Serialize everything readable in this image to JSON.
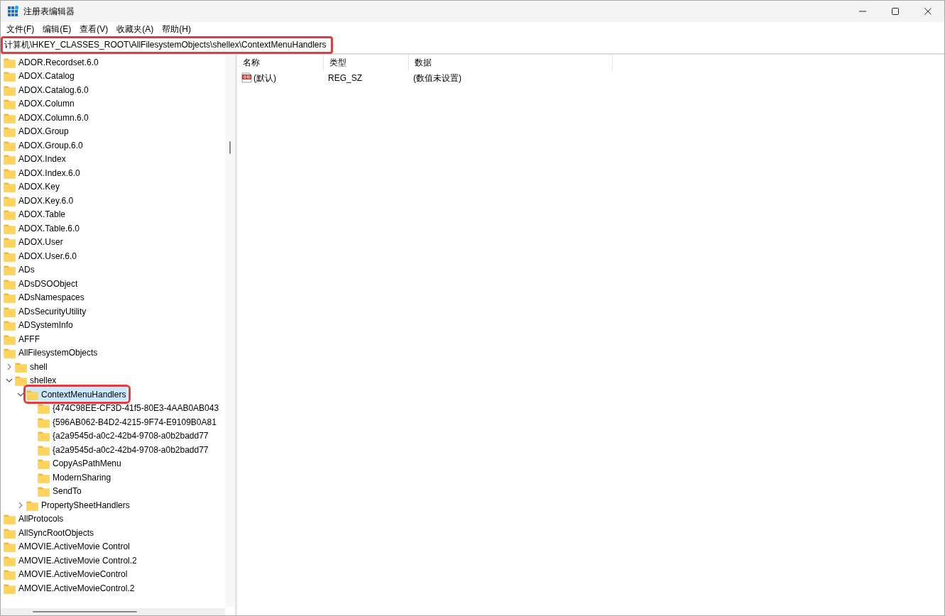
{
  "window": {
    "title": "注册表编辑器"
  },
  "menu": [
    "文件(F)",
    "编辑(E)",
    "查看(V)",
    "收藏夹(A)",
    "帮助(H)"
  ],
  "address_bar": {
    "value": "计算机\\HKEY_CLASSES_ROOT\\AllFilesystemObjects\\shellex\\ContextMenuHandlers",
    "highlighted": true
  },
  "tree": [
    {
      "label": "ADOR.Recordset.6.0",
      "selected": false
    },
    {
      "label": "ADOX.Catalog",
      "selected": false
    },
    {
      "label": "ADOX.Catalog.6.0",
      "selected": false
    },
    {
      "label": "ADOX.Column",
      "selected": false
    },
    {
      "label": "ADOX.Column.6.0",
      "selected": false
    },
    {
      "label": "ADOX.Group",
      "selected": false
    },
    {
      "label": "ADOX.Group.6.0",
      "selected": false
    },
    {
      "label": "ADOX.Index",
      "selected": false
    },
    {
      "label": "ADOX.Index.6.0",
      "selected": false
    },
    {
      "label": "ADOX.Key",
      "selected": false
    },
    {
      "label": "ADOX.Key.6.0",
      "selected": false
    },
    {
      "label": "ADOX.Table",
      "selected": false
    },
    {
      "label": "ADOX.Table.6.0",
      "selected": false
    },
    {
      "label": "ADOX.User",
      "selected": false
    },
    {
      "label": "ADOX.User.6.0",
      "selected": false
    },
    {
      "label": "ADs",
      "selected": false
    },
    {
      "label": "ADsDSOObject",
      "selected": false
    },
    {
      "label": "ADsNamespaces",
      "selected": false
    },
    {
      "label": "ADsSecurityUtility",
      "selected": false
    },
    {
      "label": "ADSystemInfo",
      "selected": false
    },
    {
      "label": "AFFF",
      "selected": false
    },
    {
      "label": "AllFilesystemObjects",
      "selected": false,
      "children": [
        {
          "label": "shell",
          "selected": false,
          "expanded": false
        },
        {
          "label": "shellex",
          "selected": false,
          "expanded": true,
          "children": [
            {
              "label": "ContextMenuHandlers",
              "selected": true,
              "expanded": true,
              "highlighted": true,
              "children": [
                {
                  "label": "{474C98EE-CF3D-41f5-80E3-4AAB0AB043",
                  "selected": false
                },
                {
                  "label": "{596AB062-B4D2-4215-9F74-E9109B0A81",
                  "selected": false
                },
                {
                  "label": "{a2a9545d-a0c2-42b4-9708-a0b2badd77",
                  "selected": false
                },
                {
                  "label": "{a2a9545d-a0c2-42b4-9708-a0b2badd77",
                  "selected": false
                },
                {
                  "label": "CopyAsPathMenu",
                  "selected": false
                },
                {
                  "label": "ModernSharing",
                  "selected": false
                },
                {
                  "label": "SendTo",
                  "selected": false
                }
              ]
            },
            {
              "label": "PropertySheetHandlers",
              "selected": false,
              "expanded": false
            }
          ]
        }
      ]
    },
    {
      "label": "AllProtocols",
      "selected": false
    },
    {
      "label": "AllSyncRootObjects",
      "selected": false
    },
    {
      "label": "AMOVIE.ActiveMovie Control",
      "selected": false
    },
    {
      "label": "AMOVIE.ActiveMovie Control.2",
      "selected": false
    },
    {
      "label": "AMOVIE.ActiveMovieControl",
      "selected": false
    },
    {
      "label": "AMOVIE.ActiveMovieControl.2",
      "selected": false
    }
  ],
  "values_list": {
    "columns": [
      "名称",
      "类型",
      "数据"
    ],
    "rows": [
      {
        "kind": "string",
        "name": "(默认)",
        "type": "REG_SZ",
        "data": "(数值未设置)"
      }
    ]
  }
}
